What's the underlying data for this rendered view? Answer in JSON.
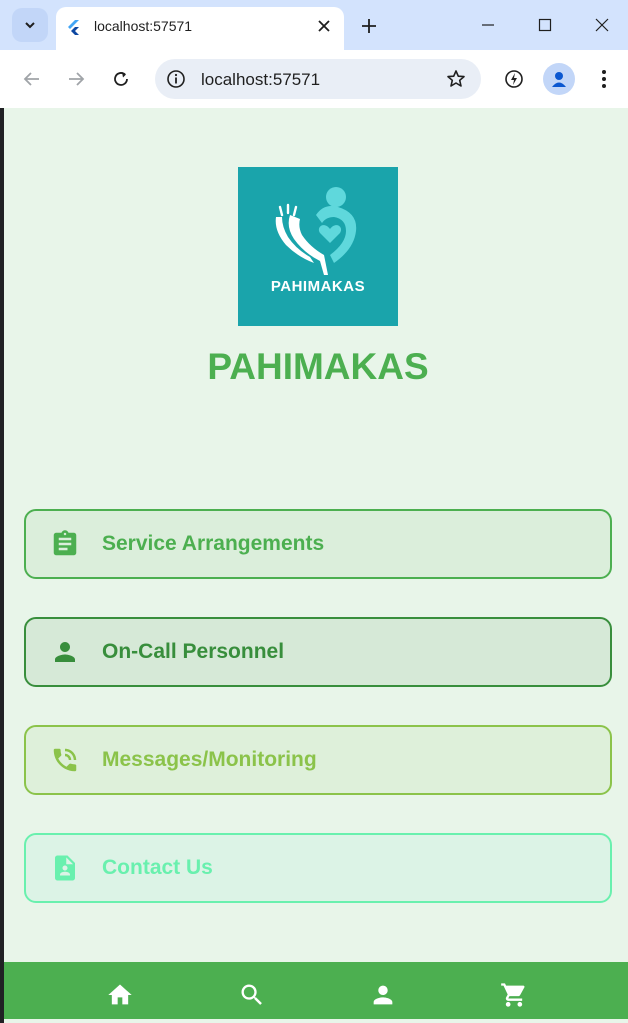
{
  "browser": {
    "tab_title": "localhost:57571",
    "url": "localhost:57571"
  },
  "app": {
    "logo_text": "PAHIMAKAS",
    "title": "PAHIMAKAS"
  },
  "menu": [
    {
      "label": "Service Arrangements",
      "icon": "clipboard-icon",
      "color": "#4caf50"
    },
    {
      "label": "On-Call Personnel",
      "icon": "person-icon",
      "color": "#388e3c"
    },
    {
      "label": "Messages/Monitoring",
      "icon": "phone-callback-icon",
      "color": "#8bc34a"
    },
    {
      "label": "Contact Us",
      "icon": "contact-page-icon",
      "color": "#69f0ae"
    }
  ],
  "bottom_nav": [
    {
      "icon": "home-icon"
    },
    {
      "icon": "search-icon"
    },
    {
      "icon": "person-icon"
    },
    {
      "icon": "cart-icon"
    }
  ],
  "colors": {
    "background": "#e8f5e9",
    "primary": "#4caf50",
    "logo_bg": "#1aa4ab"
  }
}
